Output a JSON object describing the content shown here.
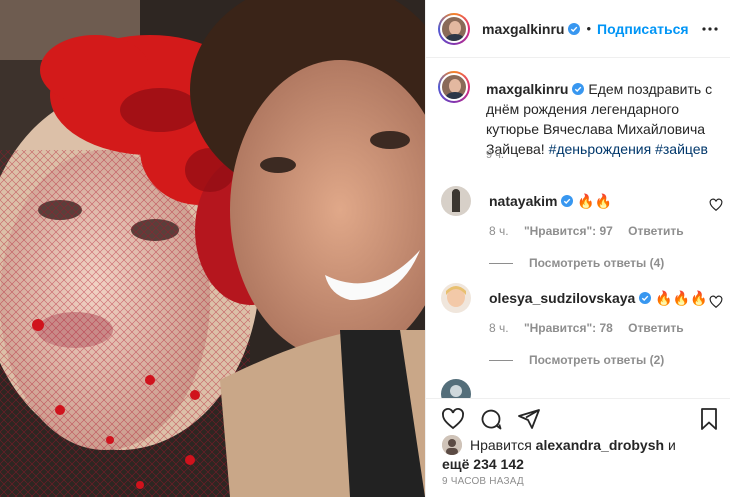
{
  "post": {
    "username": "maxgalkinru",
    "follow_label": "Подписаться",
    "separator": "•"
  },
  "caption": {
    "username": "maxgalkinru",
    "text": "Едем поздравить с днём рождения легендарного кутюрье Вячеслава Михайловича Зайцева!",
    "tags": [
      "#деньрождения",
      "#зайцев"
    ],
    "time": "9 ч."
  },
  "comments": [
    {
      "username": "natayakim",
      "text": "🔥🔥",
      "time": "8 ч.",
      "likes_label": "\"Нравится\": 97",
      "reply_label": "Ответить",
      "view_replies": "Посмотреть ответы (4)"
    },
    {
      "username": "olesya_sudzilovskaya",
      "text": "🔥🔥🔥",
      "time": "8 ч.",
      "likes_label": "\"Нравится\": 78",
      "reply_label": "Ответить",
      "view_replies": "Посмотреть ответы (2)"
    }
  ],
  "likes": {
    "prefix": "Нравится",
    "user": "alexandra_drobysh",
    "conj": "и",
    "more_prefix": "ещё",
    "count": "234 142"
  },
  "posted_ago": "9 ЧАСОВ НАЗАД",
  "colors": {
    "accent": "#0095f6",
    "verified": "#3897f0",
    "fire": "#ff6a00"
  }
}
